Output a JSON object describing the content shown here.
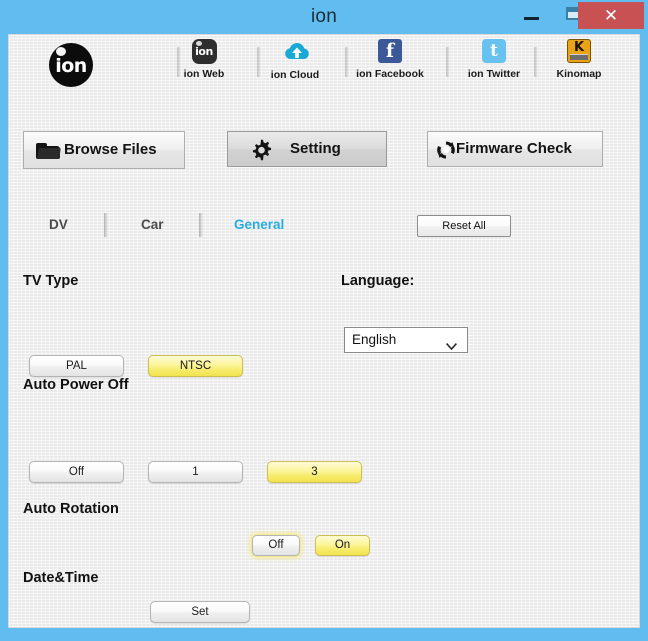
{
  "window": {
    "title": "ion",
    "minimize_label": "minimize",
    "maximize_label": "maximize",
    "close_label": "✕"
  },
  "brand_header": {
    "logo_text": "ion",
    "items": [
      {
        "label": "ion Web",
        "icon": "ion-web-icon",
        "icon_text": "ion"
      },
      {
        "label": "ion Cloud",
        "icon": "cloud-upload-icon"
      },
      {
        "label": "ion Facebook",
        "icon": "facebook-icon",
        "icon_text": "f"
      },
      {
        "label": "ion Twitter",
        "icon": "twitter-icon",
        "icon_text": "t"
      },
      {
        "label": "Kinomap",
        "icon": "kinomap-icon",
        "icon_text": "K"
      }
    ]
  },
  "toolbar": {
    "browse_files_label": "Browse Files",
    "setting_label": "Setting",
    "firmware_check_label": "Firmware Check"
  },
  "tabs": {
    "items": [
      {
        "label": "DV",
        "active": false
      },
      {
        "label": "Car",
        "active": false
      },
      {
        "label": "General",
        "active": true
      }
    ],
    "reset_all_label": "Reset All"
  },
  "settings": {
    "tv_type": {
      "label": "TV Type",
      "options": [
        {
          "label": "PAL",
          "selected": false
        },
        {
          "label": "NTSC",
          "selected": true
        }
      ]
    },
    "language": {
      "label": "Language:",
      "value": "English",
      "options": [
        "English"
      ]
    },
    "auto_power_off": {
      "label": "Auto Power Off",
      "options": [
        {
          "label": "Off",
          "selected": false
        },
        {
          "label": "1",
          "selected": false
        },
        {
          "label": "3",
          "selected": true
        }
      ]
    },
    "auto_rotation": {
      "label": "Auto Rotation",
      "options": [
        {
          "label": "Off",
          "selected": false
        },
        {
          "label": "On",
          "selected": true
        }
      ]
    },
    "date_time": {
      "label": "Date&Time",
      "set_label": "Set"
    }
  },
  "colors": {
    "window_frame": "#61bdef",
    "close_button": "#c85154",
    "active_tab": "#29abe2",
    "selected_option": "#f7eb6c",
    "client_background": "#f0f0f0"
  }
}
